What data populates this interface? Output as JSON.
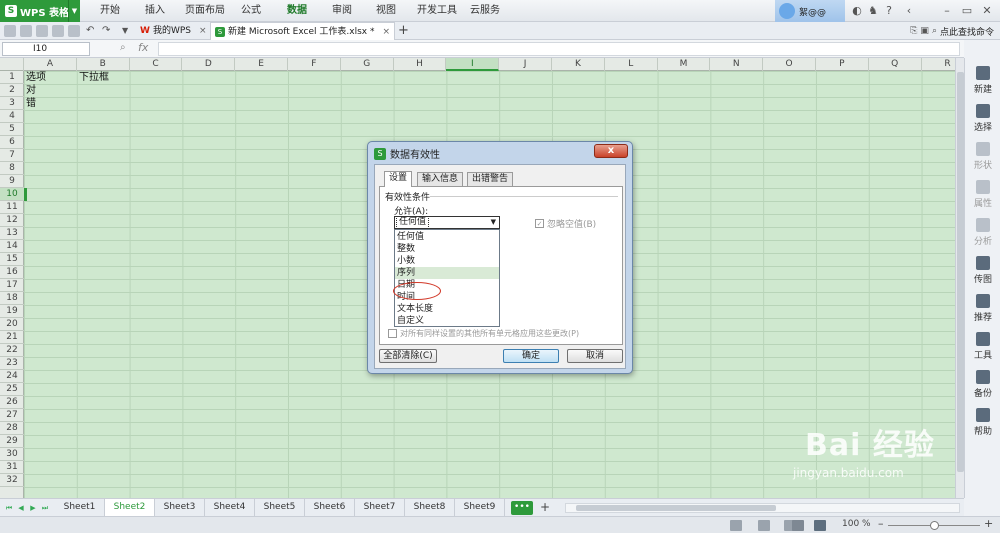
{
  "app": {
    "name": "WPS 表格",
    "logo": "S"
  },
  "ribbon": {
    "tabs": [
      "开始",
      "插入",
      "页面布局",
      "公式",
      "数据",
      "审阅",
      "视图",
      "开发工具",
      "云服务"
    ],
    "active": "数据"
  },
  "user": {
    "name": "絮@@"
  },
  "doctabs": [
    {
      "label": "我的WPS",
      "type": "wps"
    },
    {
      "label": "新建 Microsoft Excel 工作表.xlsx *",
      "type": "sheet",
      "active": true
    }
  ],
  "search_command": "点此查找命令",
  "namebox": "I10",
  "fx": "fx",
  "columns": [
    "A",
    "B",
    "C",
    "D",
    "E",
    "F",
    "G",
    "H",
    "I",
    "J",
    "K",
    "L",
    "M",
    "N",
    "O",
    "P",
    "Q",
    "R"
  ],
  "selected_column": "I",
  "selected_row": "10",
  "rows": [
    "1",
    "2",
    "3",
    "4",
    "5",
    "6",
    "7",
    "8",
    "9",
    "10",
    "11",
    "12",
    "13",
    "14",
    "15",
    "16",
    "17",
    "18",
    "19",
    "20",
    "21",
    "22",
    "23",
    "24",
    "25",
    "26",
    "27",
    "28",
    "29",
    "30",
    "31",
    "32"
  ],
  "cells": {
    "A1": "选项",
    "B1": "下拉框",
    "A2": "对",
    "A3": "错"
  },
  "side_panel": [
    {
      "label": "新建",
      "enabled": true
    },
    {
      "label": "选择",
      "enabled": true
    },
    {
      "label": "形状",
      "enabled": false
    },
    {
      "label": "属性",
      "enabled": false
    },
    {
      "label": "分析",
      "enabled": false
    },
    {
      "label": "传图",
      "enabled": true
    },
    {
      "label": "推荐",
      "enabled": true
    },
    {
      "label": "工具",
      "enabled": true
    },
    {
      "label": "备份",
      "enabled": true
    },
    {
      "label": "帮助",
      "enabled": true
    }
  ],
  "sheets": [
    "Sheet1",
    "Sheet2",
    "Sheet3",
    "Sheet4",
    "Sheet5",
    "Sheet6",
    "Sheet7",
    "Sheet8",
    "Sheet9"
  ],
  "active_sheet": "Sheet2",
  "more_sheets": "•••",
  "add_sheet": "+",
  "zoom": "100 %",
  "dialog": {
    "title": "数据有效性",
    "close": "x",
    "tabs": [
      "设置",
      "输入信息",
      "出错警告"
    ],
    "active_tab": "设置",
    "group_label": "有效性条件",
    "allow_label": "允许(A):",
    "allow_value": "任何值",
    "options": [
      "任何值",
      "整数",
      "小数",
      "序列",
      "日期",
      "时间",
      "文本长度",
      "自定义"
    ],
    "hovered_option": "序列",
    "ignore_blank": "忽略空值(B)",
    "apply_all": "对所有同样设置的其他所有单元格应用这些更改(P)",
    "clear_all": "全部清除(C)",
    "ok": "确定",
    "cancel": "取消"
  },
  "watermark": {
    "text": "Bai 经验",
    "url": "jingyan.baidu.com"
  }
}
